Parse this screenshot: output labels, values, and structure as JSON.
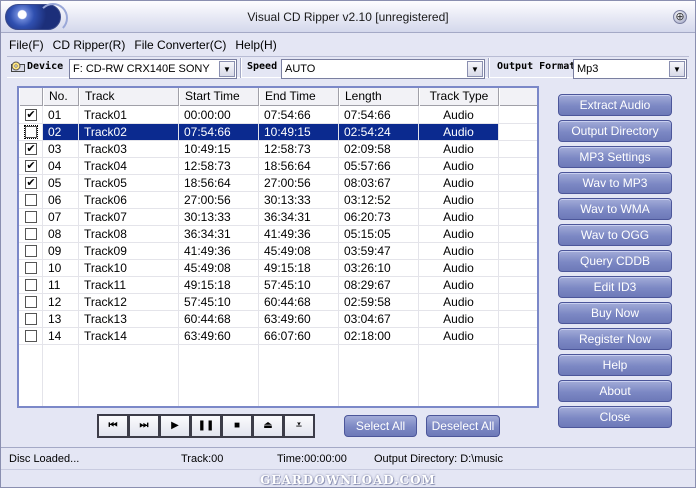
{
  "window": {
    "title": "Visual CD Ripper v2.10 [unregistered]"
  },
  "menu": [
    "File(F)",
    "CD Ripper(R)",
    "File Converter(C)",
    "Help(H)"
  ],
  "devicebar": {
    "device_label": "Device",
    "device_value": "F: CD-RW  CRX140E   SONY",
    "speed_label": "Speed",
    "speed_value": "AUTO",
    "output_label": "Output Format",
    "output_value": "Mp3"
  },
  "table": {
    "columns": [
      "No.",
      "Track",
      "Start Time",
      "End Time",
      "Length",
      "Track Type"
    ],
    "rows": [
      {
        "checked": true,
        "no": "01",
        "track": "Track01",
        "start": "00:00:00",
        "end": "07:54:66",
        "length": "07:54:66",
        "type": "Audio",
        "selected": false
      },
      {
        "checked": true,
        "no": "02",
        "track": "Track02",
        "start": "07:54:66",
        "end": "10:49:15",
        "length": "02:54:24",
        "type": "Audio",
        "selected": true
      },
      {
        "checked": true,
        "no": "03",
        "track": "Track03",
        "start": "10:49:15",
        "end": "12:58:73",
        "length": "02:09:58",
        "type": "Audio",
        "selected": false
      },
      {
        "checked": true,
        "no": "04",
        "track": "Track04",
        "start": "12:58:73",
        "end": "18:56:64",
        "length": "05:57:66",
        "type": "Audio",
        "selected": false
      },
      {
        "checked": true,
        "no": "05",
        "track": "Track05",
        "start": "18:56:64",
        "end": "27:00:56",
        "length": "08:03:67",
        "type": "Audio",
        "selected": false
      },
      {
        "checked": false,
        "no": "06",
        "track": "Track06",
        "start": "27:00:56",
        "end": "30:13:33",
        "length": "03:12:52",
        "type": "Audio",
        "selected": false
      },
      {
        "checked": false,
        "no": "07",
        "track": "Track07",
        "start": "30:13:33",
        "end": "36:34:31",
        "length": "06:20:73",
        "type": "Audio",
        "selected": false
      },
      {
        "checked": false,
        "no": "08",
        "track": "Track08",
        "start": "36:34:31",
        "end": "41:49:36",
        "length": "05:15:05",
        "type": "Audio",
        "selected": false
      },
      {
        "checked": false,
        "no": "09",
        "track": "Track09",
        "start": "41:49:36",
        "end": "45:49:08",
        "length": "03:59:47",
        "type": "Audio",
        "selected": false
      },
      {
        "checked": false,
        "no": "10",
        "track": "Track10",
        "start": "45:49:08",
        "end": "49:15:18",
        "length": "03:26:10",
        "type": "Audio",
        "selected": false
      },
      {
        "checked": false,
        "no": "11",
        "track": "Track11",
        "start": "49:15:18",
        "end": "57:45:10",
        "length": "08:29:67",
        "type": "Audio",
        "selected": false
      },
      {
        "checked": false,
        "no": "12",
        "track": "Track12",
        "start": "57:45:10",
        "end": "60:44:68",
        "length": "02:59:58",
        "type": "Audio",
        "selected": false
      },
      {
        "checked": false,
        "no": "13",
        "track": "Track13",
        "start": "60:44:68",
        "end": "63:49:60",
        "length": "03:04:67",
        "type": "Audio",
        "selected": false
      },
      {
        "checked": false,
        "no": "14",
        "track": "Track14",
        "start": "63:49:60",
        "end": "66:07:60",
        "length": "02:18:00",
        "type": "Audio",
        "selected": false
      }
    ]
  },
  "side_buttons": [
    "Extract Audio",
    "Output Directory",
    "MP3 Settings",
    "Wav to MP3",
    "Wav to WMA",
    "Wav to OGG",
    "Query CDDB",
    "Edit ID3",
    "Buy Now",
    "Register Now",
    "Help",
    "About",
    "Close"
  ],
  "transport": [
    {
      "name": "prev-track",
      "glyph": "⏮"
    },
    {
      "name": "next-track",
      "glyph": "⏭"
    },
    {
      "name": "play",
      "glyph": "▶"
    },
    {
      "name": "pause",
      "glyph": "❚❚"
    },
    {
      "name": "stop",
      "glyph": "■"
    },
    {
      "name": "eject",
      "glyph": "⏏"
    },
    {
      "name": "load",
      "glyph": "⩡"
    }
  ],
  "select_all": "Select All",
  "deselect_all": "Deselect All",
  "status": {
    "disc": "Disc Loaded...",
    "track": "Track:00",
    "time": "Time:00:00:00",
    "output": "Output Directory: D:\\music"
  },
  "watermark": "GEARDOWNLOAD.COM"
}
